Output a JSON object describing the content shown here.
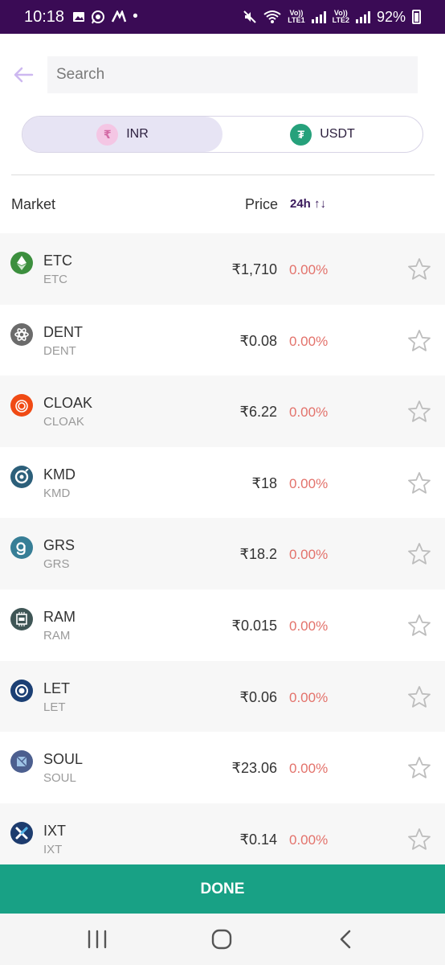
{
  "status_bar": {
    "time": "10:18",
    "battery": "92%",
    "sim1": "LTE1",
    "sim2": "LTE2",
    "volte": "Vo))"
  },
  "search": {
    "placeholder": "Search",
    "value": ""
  },
  "currency_toggle": {
    "options": [
      {
        "label": "INR",
        "icon": "rupee-icon",
        "active": true
      },
      {
        "label": "USDT",
        "icon": "tether-icon",
        "active": false
      }
    ]
  },
  "table": {
    "headers": {
      "market": "Market",
      "price": "Price",
      "change": "24h",
      "sort_glyph": "↑↓"
    },
    "rows": [
      {
        "symbol": "ETC",
        "name": "ETC",
        "price": "₹1,710",
        "change": "0.00%",
        "icon": "etc-icon",
        "color": "#3c8f3e"
      },
      {
        "symbol": "DENT",
        "name": "DENT",
        "price": "₹0.08",
        "change": "0.00%",
        "icon": "dent-icon",
        "color": "#6b6b6b"
      },
      {
        "symbol": "CLOAK",
        "name": "CLOAK",
        "price": "₹6.22",
        "change": "0.00%",
        "icon": "cloak-icon",
        "color": "#f04a14"
      },
      {
        "symbol": "KMD",
        "name": "KMD",
        "price": "₹18",
        "change": "0.00%",
        "icon": "kmd-icon",
        "color": "#2c5f7a"
      },
      {
        "symbol": "GRS",
        "name": "GRS",
        "price": "₹18.2",
        "change": "0.00%",
        "icon": "grs-icon",
        "color": "#377e96"
      },
      {
        "symbol": "RAM",
        "name": "RAM",
        "price": "₹0.015",
        "change": "0.00%",
        "icon": "ram-icon",
        "color": "#3f5656"
      },
      {
        "symbol": "LET",
        "name": "LET",
        "price": "₹0.06",
        "change": "0.00%",
        "icon": "let-icon",
        "color": "#1b3f74"
      },
      {
        "symbol": "SOUL",
        "name": "SOUL",
        "price": "₹23.06",
        "change": "0.00%",
        "icon": "soul-icon",
        "color": "#4c5f8f"
      },
      {
        "symbol": "IXT",
        "name": "IXT",
        "price": "₹0.14",
        "change": "0.00%",
        "icon": "ixt-icon",
        "color": "#1d3c6e"
      }
    ]
  },
  "done_button": {
    "label": "DONE"
  },
  "colors": {
    "status_bar": "#3a0b55",
    "accent": "#18a185",
    "negative": "#e3726b",
    "toggle_active": "#e7e4f4"
  }
}
